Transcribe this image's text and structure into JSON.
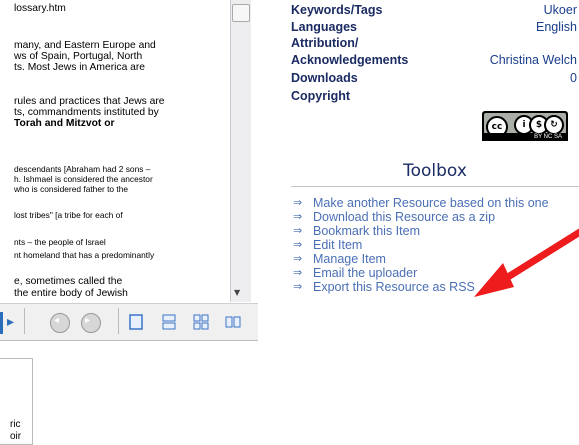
{
  "viewer": {
    "lines": [
      {
        "text": "lossary.htm",
        "cls": ""
      },
      {
        "text": "many, and Eastern Europe and",
        "cls": ""
      },
      {
        "text": "ws of Spain, Portugal, North",
        "cls": ""
      },
      {
        "text": "ts. Most Jews in America are",
        "cls": ""
      },
      {
        "text": "rules and practices that Jews are",
        "cls": ""
      },
      {
        "text": "ts, commandments instituted by",
        "cls": ""
      },
      {
        "text": "Torah and Mitzvot or",
        "cls": ""
      },
      {
        "text": "descendants [Abraham had 2 sons –",
        "cls": "sm"
      },
      {
        "text": "h. Ishmael is considered the ancestor",
        "cls": "sm"
      },
      {
        "text": "who is considered father to the",
        "cls": "sm"
      },
      {
        "text": "lost tribes\" [a tribe for each of",
        "cls": "sm"
      },
      {
        "text": "nts – the people of Israel",
        "cls": "sm"
      },
      {
        "text": "nt homeland that has a predominantly",
        "cls": "sm"
      },
      {
        "text": "e,  sometimes called the",
        "cls": ""
      },
      {
        "text": "the entire body of Jewish",
        "cls": ""
      }
    ],
    "thumbnail_text": [
      "ric",
      "oir"
    ]
  },
  "meta": {
    "rows": [
      {
        "label": "Keywords/Tags",
        "value": "Ukoer"
      },
      {
        "label": "Languages",
        "value": "English"
      },
      {
        "label": "Attribution/",
        "value": ""
      },
      {
        "label": "Acknowledgements",
        "value": "Christina Welch"
      },
      {
        "label": "Downloads",
        "value": "0"
      },
      {
        "label": "Copyright",
        "value": ""
      }
    ],
    "license_badge": "BY  NC  SA"
  },
  "toolbox": {
    "title": "Toolbox",
    "items": [
      "Make another Resource based on this one",
      "Download this Resource as a zip",
      "Bookmark this Item",
      "Edit Item",
      "Manage Item",
      "Email the uploader",
      "Export this Resource as RSS"
    ]
  },
  "colors": {
    "label": "#1b2b63",
    "link": "#4a6fb5",
    "annotation_arrow": "#ee1c1c"
  }
}
